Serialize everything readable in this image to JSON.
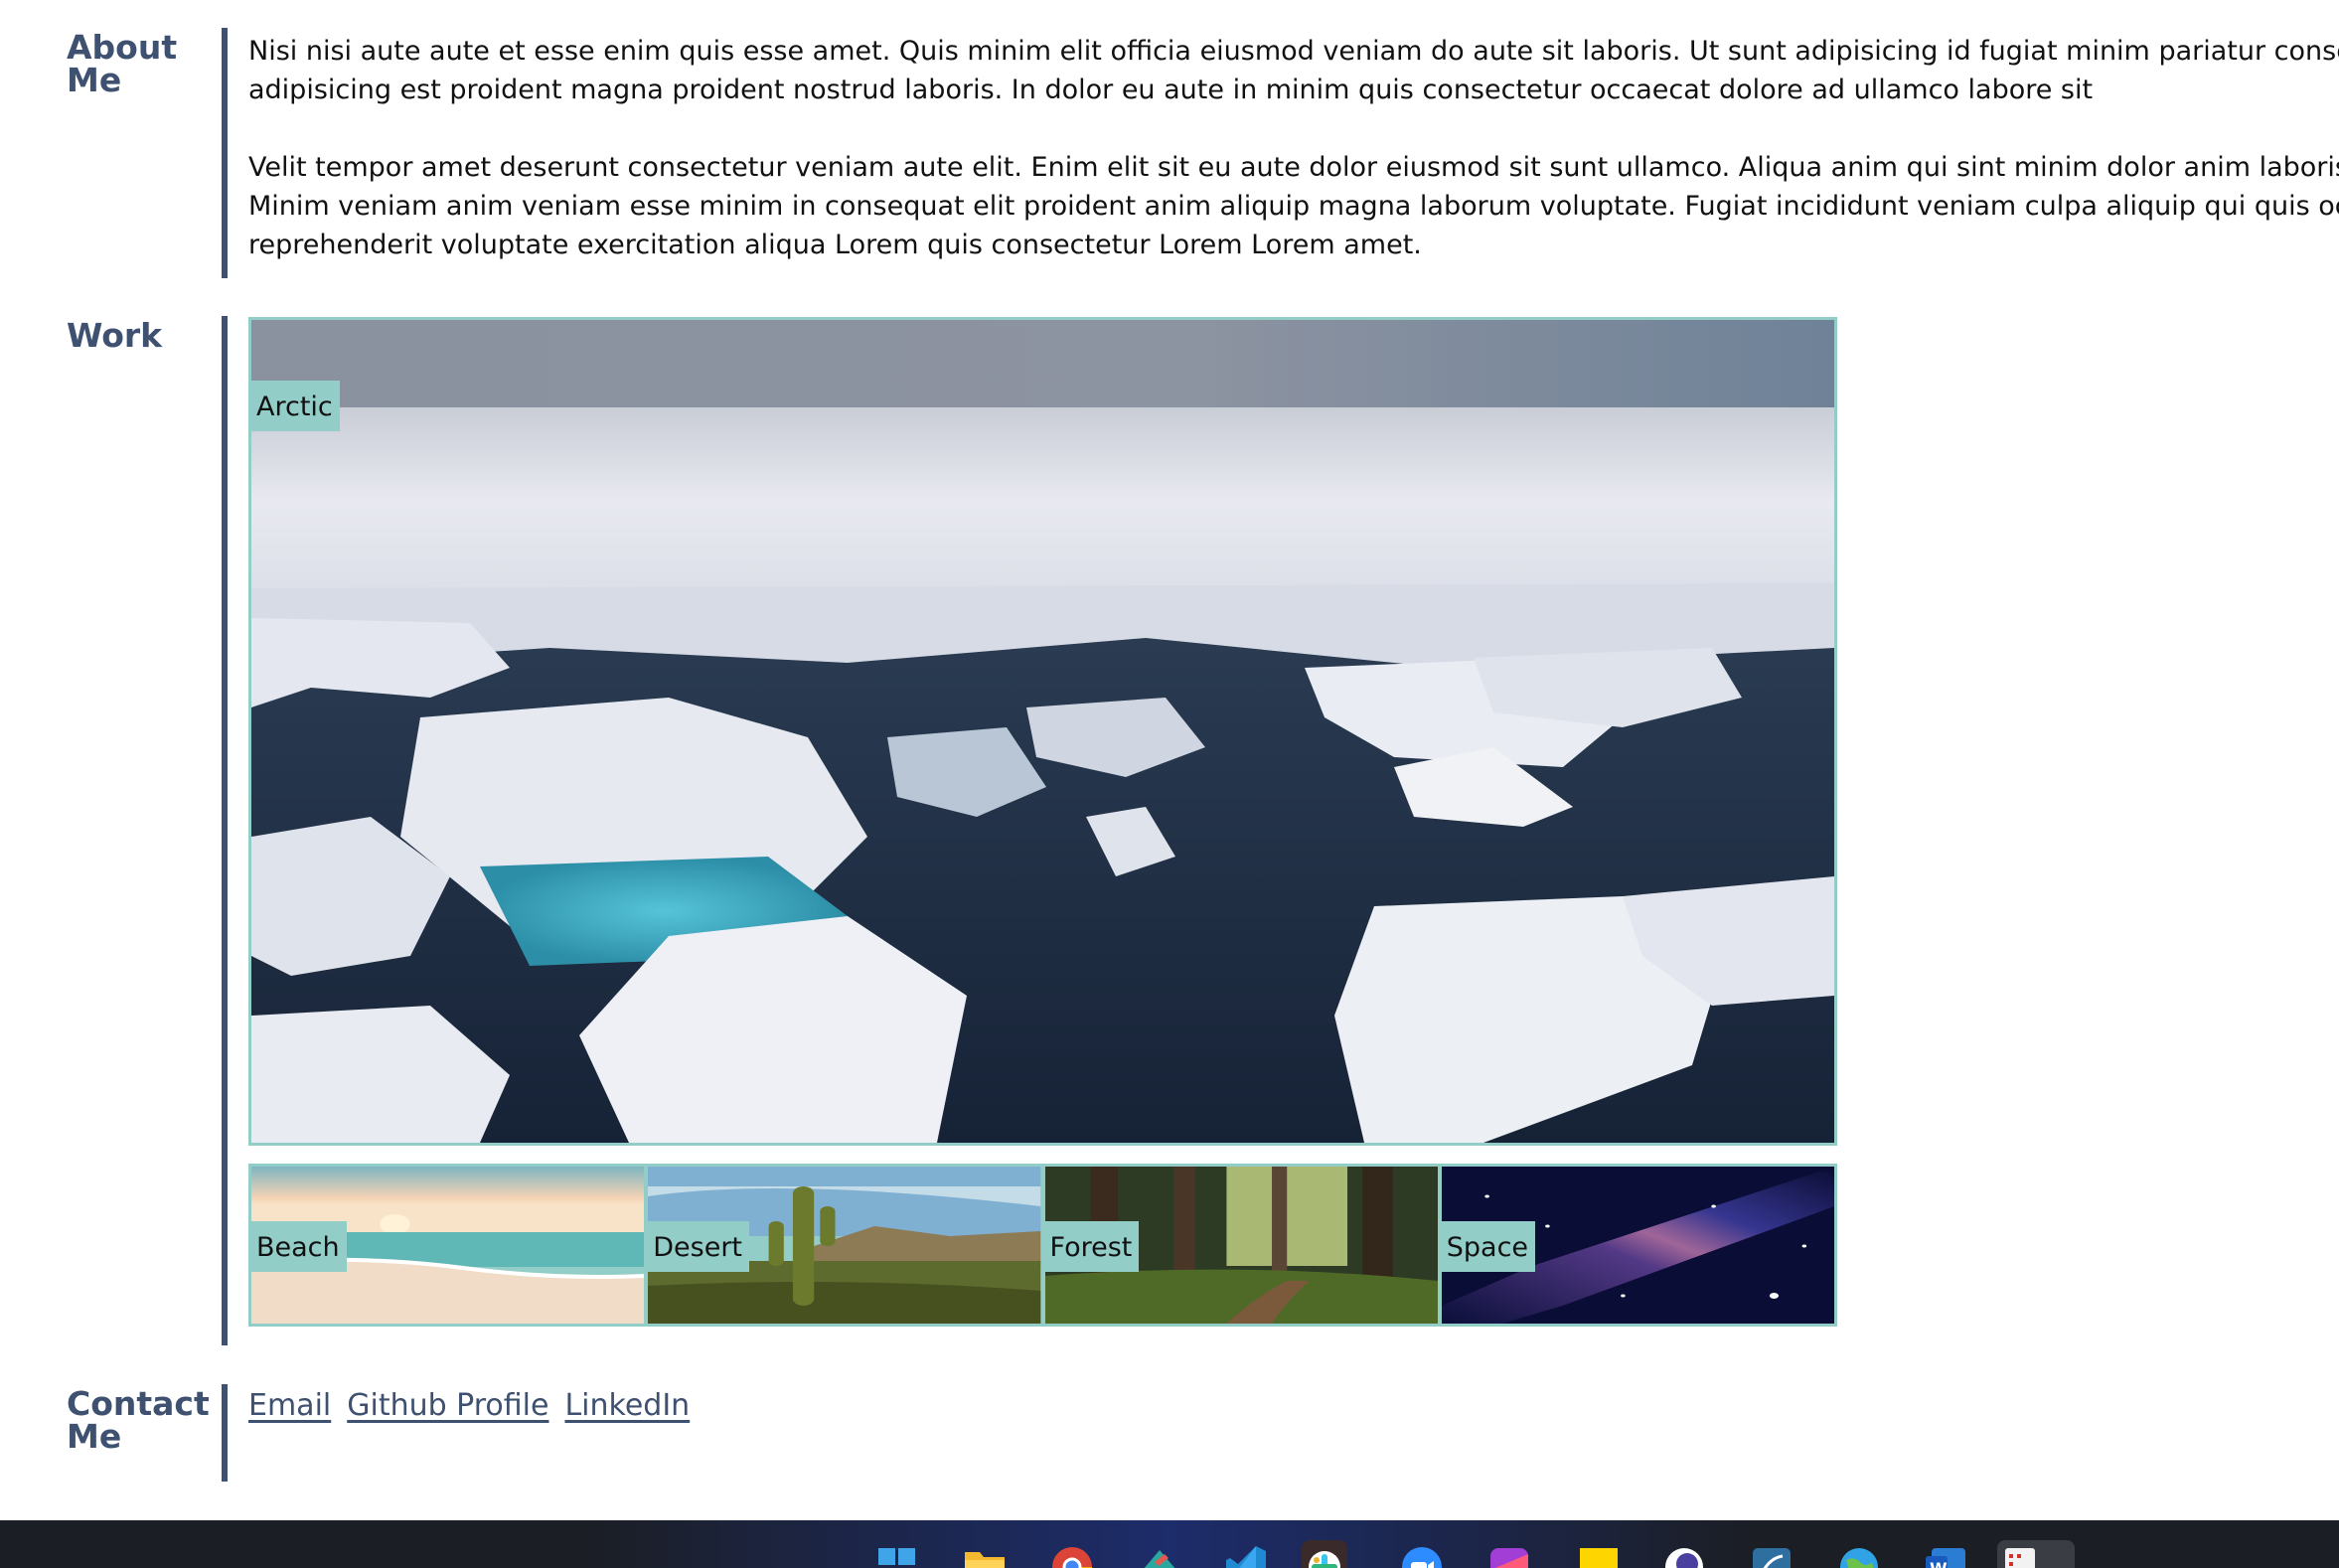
{
  "about": {
    "title": "About Me",
    "paragraphs": [
      "Nisi nisi aute aute et esse enim quis esse amet. Quis minim elit officia eiusmod veniam do aute sit laboris. Ut sunt adipisicing id fugiat minim pariatur consectet",
      "adipisicing est proident magna proident nostrud laboris. In dolor eu aute in minim quis consectetur occaecat dolore ad ullamco labore sit",
      "Velit tempor amet deserunt consectetur veniam aute elit. Enim elit sit eu aute dolor eiusmod sit sunt ullamco. Aliqua anim qui sint minim dolor anim laboris. En",
      "Minim veniam anim veniam esse minim in consequat elit proident anim aliquip magna laborum voluptate. Fugiat incididunt veniam culpa aliquip qui quis occaec",
      "reprehenderit voluptate exercitation aliqua Lorem quis consectetur Lorem Lorem amet."
    ]
  },
  "work": {
    "title": "Work",
    "featured": {
      "label": "Arctic"
    },
    "thumbnails": [
      {
        "label": "Beach"
      },
      {
        "label": "Desert"
      },
      {
        "label": "Forest"
      },
      {
        "label": "Space"
      }
    ]
  },
  "contact": {
    "title": "Contact Me",
    "links": [
      "Email",
      "Github Profile",
      "LinkedIn"
    ]
  },
  "taskbar": {
    "icons": [
      "windows-start-icon",
      "file-explorer-icon",
      "chrome-icon",
      "git-tool-icon",
      "vscode-icon",
      "slack-icon",
      "zoom-icon",
      "figma-icon",
      "sticky-notes-icon",
      "browser-icon",
      "mysql-workbench-icon",
      "globe-icon",
      "word-icon",
      "app-icon"
    ]
  },
  "colors": {
    "heading": "#3f5170",
    "accent_border": "#92cdc7",
    "text": "#111111",
    "taskbar": "#1b1e24"
  }
}
